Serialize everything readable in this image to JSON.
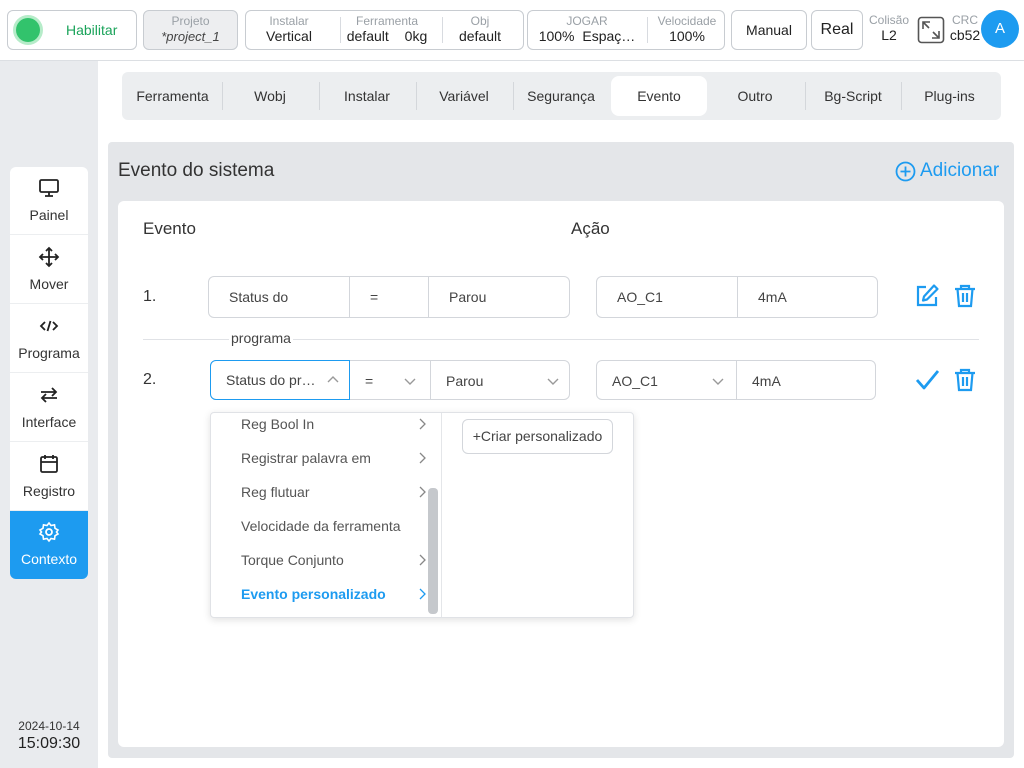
{
  "topbar": {
    "enable_label": "Habilitar",
    "project_label": "Projeto",
    "project_value": "*project_1",
    "install_label": "Instalar",
    "install_value": "Vertical",
    "tool_label": "Ferramenta",
    "tool_value": "default",
    "tool_weight": "0kg",
    "obj_label": "Obj",
    "obj_value": "default",
    "jog_label": "JOGAR",
    "jog_value": "100%",
    "jog_space": "Espaç…",
    "speed_label": "Velocidade",
    "speed_value": "100%",
    "manual_label": "Manual",
    "real_label": "Real",
    "collision_label": "Colisão",
    "collision_value": "L2",
    "crc_label": "CRC",
    "crc_value": "cb52",
    "avatar_letter": "A"
  },
  "tabs": [
    "Ferramenta",
    "Wobj",
    "Instalar",
    "Variável",
    "Segurança",
    "Evento",
    "Outro",
    "Bg-Script",
    "Plug-ins"
  ],
  "active_tab": "Evento",
  "sidebar": {
    "items": [
      {
        "label": "Painel",
        "icon": "monitor-icon"
      },
      {
        "label": "Mover",
        "icon": "move-icon"
      },
      {
        "label": "Programa",
        "icon": "code-icon"
      },
      {
        "label": "Interface",
        "icon": "swap-icon"
      },
      {
        "label": "Registro",
        "icon": "calendar-icon"
      },
      {
        "label": "Contexto",
        "icon": "settings-icon"
      }
    ],
    "active": "Contexto"
  },
  "datetime": {
    "date": "2024-10-14",
    "time": "15:09:30"
  },
  "main": {
    "title": "Evento do sistema",
    "add_label": "Adicionar",
    "col_event": "Evento",
    "col_action": "Ação",
    "rows": [
      {
        "num": "1.",
        "event_source": "Status do",
        "event_source_wrap": "programa",
        "operator": "=",
        "event_value": "Parou",
        "action_target": "AO_C1",
        "action_value": "4mA"
      },
      {
        "num": "2.",
        "event_source": "Status do pr…",
        "operator": "=",
        "event_value": "Parou",
        "action_target": "AO_C1",
        "action_value": "4mA"
      }
    ]
  },
  "dropdown": {
    "items": [
      {
        "label": "Reg Bool In",
        "has_sub": true
      },
      {
        "label": "Registrar palavra em",
        "has_sub": true
      },
      {
        "label": "Reg flutuar",
        "has_sub": true
      },
      {
        "label": "Velocidade da ferramenta",
        "has_sub": false
      },
      {
        "label": "Torque Conjunto",
        "has_sub": true
      },
      {
        "label": "Evento personalizado",
        "has_sub": true
      }
    ],
    "selected": "Evento personalizado",
    "create_label": "+Criar personalizado"
  },
  "colors": {
    "accent": "#1d9bf0",
    "enable": "#32c36c"
  }
}
